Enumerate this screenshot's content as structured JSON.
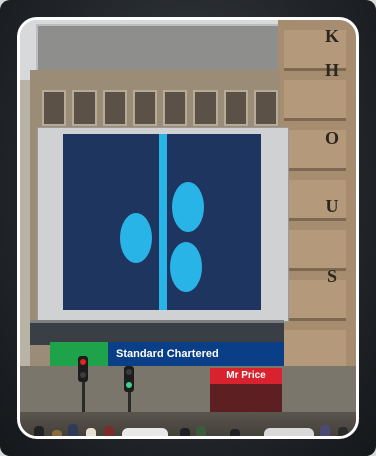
{
  "photo": {
    "tower_letters": [
      "K",
      "H",
      "O",
      "U",
      "S"
    ],
    "bank_sign": "Standard Chartered",
    "store_sign": "Mr Price",
    "billboard": {
      "background_color": "#1e3560",
      "accent_color": "#28b4e6"
    }
  }
}
